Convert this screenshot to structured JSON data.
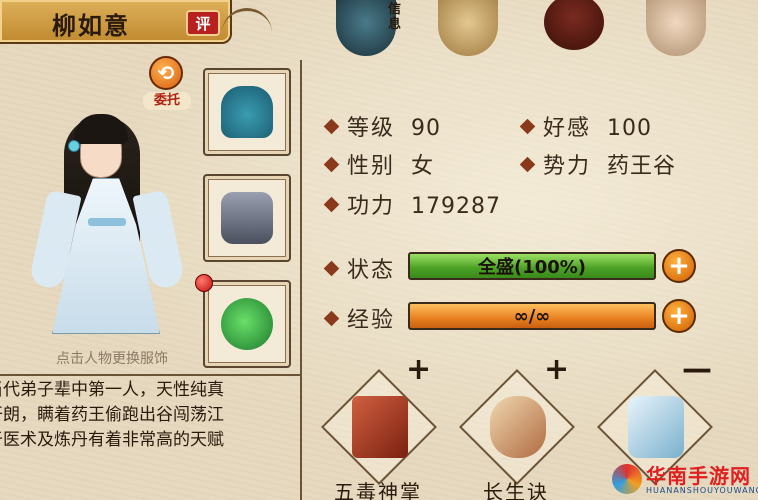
{
  "character": {
    "name": "柳如意",
    "ping_badge": "评",
    "entrust_label": "委托",
    "change_outfit_hint": "点击人物更换服饰"
  },
  "tabs": {
    "info_label": "信息"
  },
  "stats": {
    "level_label": "等级",
    "level_value": "90",
    "favor_label": "好感",
    "favor_value": "100",
    "gender_label": "性别",
    "gender_value": "女",
    "faction_label": "势力",
    "faction_value": "药王谷",
    "power_label": "功力",
    "power_value": "179287"
  },
  "bars": {
    "status_label": "状态",
    "status_text": "全盛(100%)",
    "status_fraction": 1.0,
    "exp_label": "经验",
    "exp_text": "∞/∞",
    "exp_fraction": 1.0
  },
  "bio": {
    "line1": "当代弟子辈中第一人，天性纯真",
    "line2": "开朗，瞒着药王偷跑出谷闯荡江",
    "line3": "于医术及炼丹有着非常高的天赋"
  },
  "skills": [
    {
      "name": "五毒神掌",
      "mark": "+"
    },
    {
      "name": "长生诀",
      "mark": "+"
    },
    {
      "name": "",
      "mark": "—"
    }
  ],
  "watermark": {
    "text": "华南手游网",
    "sub": "HUANANSHOUYOUWANG"
  },
  "colors": {
    "status_bar": "#4aa024",
    "exp_bar": "#e88020",
    "plus_button": "#d06000",
    "badge": "#b82020"
  }
}
